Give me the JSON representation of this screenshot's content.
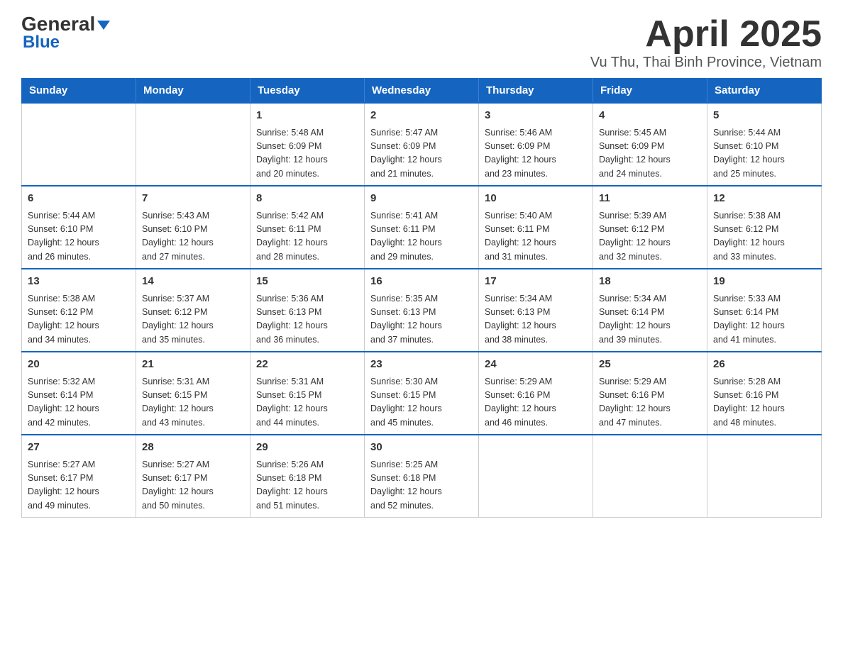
{
  "header": {
    "title": "April 2025",
    "subtitle": "Vu Thu, Thai Binh Province, Vietnam",
    "logo_line1": "General",
    "logo_line2": "Blue"
  },
  "columns": [
    "Sunday",
    "Monday",
    "Tuesday",
    "Wednesday",
    "Thursday",
    "Friday",
    "Saturday"
  ],
  "weeks": [
    [
      {
        "day": "",
        "info": ""
      },
      {
        "day": "",
        "info": ""
      },
      {
        "day": "1",
        "info": "Sunrise: 5:48 AM\nSunset: 6:09 PM\nDaylight: 12 hours\nand 20 minutes."
      },
      {
        "day": "2",
        "info": "Sunrise: 5:47 AM\nSunset: 6:09 PM\nDaylight: 12 hours\nand 21 minutes."
      },
      {
        "day": "3",
        "info": "Sunrise: 5:46 AM\nSunset: 6:09 PM\nDaylight: 12 hours\nand 23 minutes."
      },
      {
        "day": "4",
        "info": "Sunrise: 5:45 AM\nSunset: 6:09 PM\nDaylight: 12 hours\nand 24 minutes."
      },
      {
        "day": "5",
        "info": "Sunrise: 5:44 AM\nSunset: 6:10 PM\nDaylight: 12 hours\nand 25 minutes."
      }
    ],
    [
      {
        "day": "6",
        "info": "Sunrise: 5:44 AM\nSunset: 6:10 PM\nDaylight: 12 hours\nand 26 minutes."
      },
      {
        "day": "7",
        "info": "Sunrise: 5:43 AM\nSunset: 6:10 PM\nDaylight: 12 hours\nand 27 minutes."
      },
      {
        "day": "8",
        "info": "Sunrise: 5:42 AM\nSunset: 6:11 PM\nDaylight: 12 hours\nand 28 minutes."
      },
      {
        "day": "9",
        "info": "Sunrise: 5:41 AM\nSunset: 6:11 PM\nDaylight: 12 hours\nand 29 minutes."
      },
      {
        "day": "10",
        "info": "Sunrise: 5:40 AM\nSunset: 6:11 PM\nDaylight: 12 hours\nand 31 minutes."
      },
      {
        "day": "11",
        "info": "Sunrise: 5:39 AM\nSunset: 6:12 PM\nDaylight: 12 hours\nand 32 minutes."
      },
      {
        "day": "12",
        "info": "Sunrise: 5:38 AM\nSunset: 6:12 PM\nDaylight: 12 hours\nand 33 minutes."
      }
    ],
    [
      {
        "day": "13",
        "info": "Sunrise: 5:38 AM\nSunset: 6:12 PM\nDaylight: 12 hours\nand 34 minutes."
      },
      {
        "day": "14",
        "info": "Sunrise: 5:37 AM\nSunset: 6:12 PM\nDaylight: 12 hours\nand 35 minutes."
      },
      {
        "day": "15",
        "info": "Sunrise: 5:36 AM\nSunset: 6:13 PM\nDaylight: 12 hours\nand 36 minutes."
      },
      {
        "day": "16",
        "info": "Sunrise: 5:35 AM\nSunset: 6:13 PM\nDaylight: 12 hours\nand 37 minutes."
      },
      {
        "day": "17",
        "info": "Sunrise: 5:34 AM\nSunset: 6:13 PM\nDaylight: 12 hours\nand 38 minutes."
      },
      {
        "day": "18",
        "info": "Sunrise: 5:34 AM\nSunset: 6:14 PM\nDaylight: 12 hours\nand 39 minutes."
      },
      {
        "day": "19",
        "info": "Sunrise: 5:33 AM\nSunset: 6:14 PM\nDaylight: 12 hours\nand 41 minutes."
      }
    ],
    [
      {
        "day": "20",
        "info": "Sunrise: 5:32 AM\nSunset: 6:14 PM\nDaylight: 12 hours\nand 42 minutes."
      },
      {
        "day": "21",
        "info": "Sunrise: 5:31 AM\nSunset: 6:15 PM\nDaylight: 12 hours\nand 43 minutes."
      },
      {
        "day": "22",
        "info": "Sunrise: 5:31 AM\nSunset: 6:15 PM\nDaylight: 12 hours\nand 44 minutes."
      },
      {
        "day": "23",
        "info": "Sunrise: 5:30 AM\nSunset: 6:15 PM\nDaylight: 12 hours\nand 45 minutes."
      },
      {
        "day": "24",
        "info": "Sunrise: 5:29 AM\nSunset: 6:16 PM\nDaylight: 12 hours\nand 46 minutes."
      },
      {
        "day": "25",
        "info": "Sunrise: 5:29 AM\nSunset: 6:16 PM\nDaylight: 12 hours\nand 47 minutes."
      },
      {
        "day": "26",
        "info": "Sunrise: 5:28 AM\nSunset: 6:16 PM\nDaylight: 12 hours\nand 48 minutes."
      }
    ],
    [
      {
        "day": "27",
        "info": "Sunrise: 5:27 AM\nSunset: 6:17 PM\nDaylight: 12 hours\nand 49 minutes."
      },
      {
        "day": "28",
        "info": "Sunrise: 5:27 AM\nSunset: 6:17 PM\nDaylight: 12 hours\nand 50 minutes."
      },
      {
        "day": "29",
        "info": "Sunrise: 5:26 AM\nSunset: 6:18 PM\nDaylight: 12 hours\nand 51 minutes."
      },
      {
        "day": "30",
        "info": "Sunrise: 5:25 AM\nSunset: 6:18 PM\nDaylight: 12 hours\nand 52 minutes."
      },
      {
        "day": "",
        "info": ""
      },
      {
        "day": "",
        "info": ""
      },
      {
        "day": "",
        "info": ""
      }
    ]
  ]
}
